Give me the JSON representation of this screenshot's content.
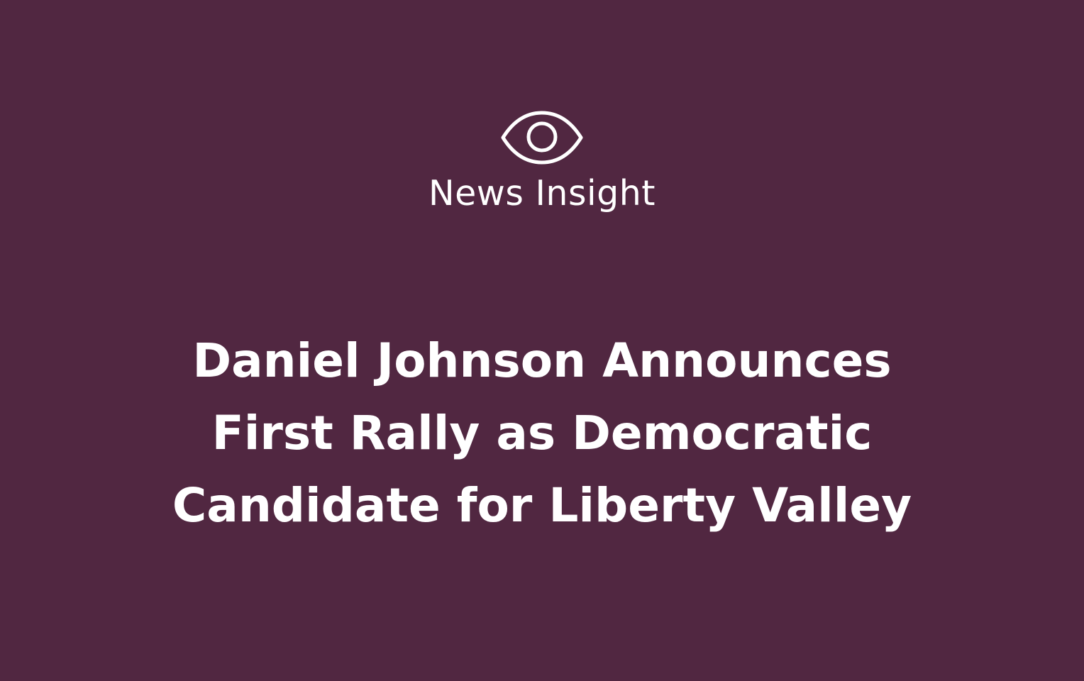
{
  "brand": {
    "icon": "eye-icon",
    "name": "News Insight"
  },
  "headline": {
    "lines": [
      "Daniel Johnson Announces",
      "First Rally as Democratic",
      "Candidate for Liberty Valley"
    ]
  },
  "colors": {
    "background": "#512741",
    "text": "#ffffff"
  }
}
